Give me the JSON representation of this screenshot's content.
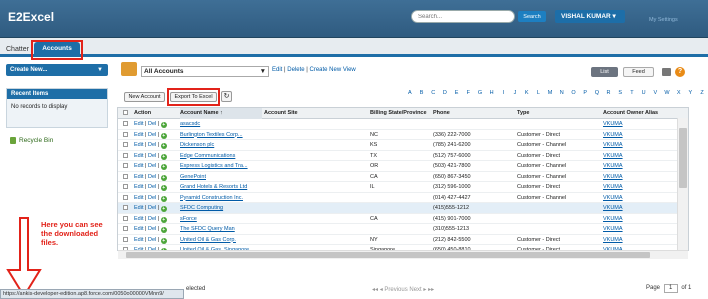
{
  "app": {
    "logo": "E2Excel",
    "search_placeholder": "Search...",
    "search_button": "Search",
    "user_menu": "VISHAL KUMAR ▾",
    "settings_link": "My Settings"
  },
  "tabs": {
    "chatter": "Chatter",
    "accounts": "Accounts"
  },
  "sidebar": {
    "create_new": "Create New...",
    "create_new_caret": "▼",
    "recent_title": "Recent Items",
    "recent_empty": "No records to display",
    "recycle_bin": "Recycle Bin"
  },
  "view": {
    "selected": "All Accounts",
    "caret": "▼",
    "edit": "Edit",
    "delete": "Delete",
    "create_view": "Create New View",
    "sep": "|"
  },
  "toolbar": {
    "list_label": "List",
    "feed_label": "Feed",
    "help_label": "?",
    "new_account": "New Account",
    "export_to_excel": "Export To Excel",
    "refresh_icon": "↻"
  },
  "alphabet": [
    "A",
    "B",
    "C",
    "D",
    "E",
    "F",
    "G",
    "H",
    "I",
    "J",
    "K",
    "L",
    "M",
    "N",
    "O",
    "P",
    "Q",
    "R",
    "S",
    "T",
    "U",
    "V",
    "W",
    "X",
    "Y",
    "Z",
    "Other",
    "All"
  ],
  "table": {
    "headers": {
      "action": "Action",
      "account_name": "Account Name ↑",
      "account_site": "Account Site",
      "billing_state": "Billing State/Province",
      "phone": "Phone",
      "type": "Type",
      "owner": "Account Owner Alias"
    },
    "action_edit": "Edit",
    "action_del": "Del",
    "action_sep": "|",
    "plus": "+",
    "rows": [
      {
        "name": "asacsdc",
        "site": "",
        "state": "",
        "phone": "",
        "type": "",
        "owner": "VKUMA"
      },
      {
        "name": "Burlington Textiles Corp...",
        "site": "",
        "state": "NC",
        "phone": "(336) 222-7000",
        "type": "Customer - Direct",
        "owner": "VKUMA"
      },
      {
        "name": "Dickenson plc",
        "site": "",
        "state": "KS",
        "phone": "(785) 241-6200",
        "type": "Customer - Channel",
        "owner": "VKUMA"
      },
      {
        "name": "Edge Communications",
        "site": "",
        "state": "TX",
        "phone": "(512) 757-6000",
        "type": "Customer - Direct",
        "owner": "VKUMA"
      },
      {
        "name": "Express Logistics and Tra...",
        "site": "",
        "state": "OR",
        "phone": "(503) 421-7800",
        "type": "Customer - Channel",
        "owner": "VKUMA"
      },
      {
        "name": "GenePoint",
        "site": "",
        "state": "CA",
        "phone": "(650) 867-3450",
        "type": "Customer - Channel",
        "owner": "VKUMA"
      },
      {
        "name": "Grand Hotels & Resorts Ltd",
        "site": "",
        "state": "IL",
        "phone": "(312) 596-1000",
        "type": "Customer - Direct",
        "owner": "VKUMA"
      },
      {
        "name": "Pyramid Construction Inc.",
        "site": "",
        "state": "",
        "phone": "(014) 427-4427",
        "type": "Customer - Channel",
        "owner": "VKUMA"
      },
      {
        "name": "SFDC Computing",
        "site": "",
        "state": "",
        "phone": "(415)555-1212",
        "type": "",
        "owner": "VKUMA"
      },
      {
        "name": "sForce",
        "site": "",
        "state": "CA",
        "phone": "(415) 901-7000",
        "type": "",
        "owner": "VKUMA"
      },
      {
        "name": "The SFDC Query Man",
        "site": "",
        "state": "",
        "phone": "(310)555-1213",
        "type": "",
        "owner": "VKUMA"
      },
      {
        "name": "United Oil & Gas Corp.",
        "site": "",
        "state": "NY",
        "phone": "(212) 842-5500",
        "type": "Customer - Direct",
        "owner": "VKUMA"
      },
      {
        "name": "United Oil & Gas, Singapore",
        "site": "",
        "state": "Singapore",
        "phone": "(650) 450-8810",
        "type": "Customer - Direct",
        "owner": "VKUMA"
      }
    ]
  },
  "footer": {
    "selected_fragment": "elected",
    "pager": "◂◂ ◂ Previous  Next ▸ ▸▸",
    "page_label": "Page",
    "page_value": "1",
    "page_of": "of 1"
  },
  "annotation": {
    "text": "Here you can see the downloaded files."
  },
  "statusbar": {
    "url": "https://ankis-developer-edition.ap8.force.com/0050o00000VMnn9/"
  },
  "colors": {
    "header": "#2f5b80",
    "tab_accent": "#1e6ea7",
    "highlight": "#e2231a",
    "link": "#015ba7"
  }
}
